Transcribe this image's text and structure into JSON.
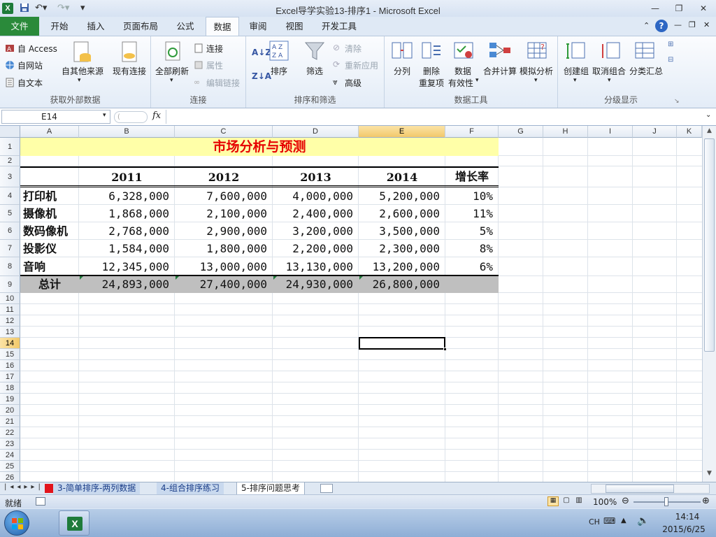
{
  "titlebar": {
    "title": "Excel导学实验13-排序1  -  Microsoft Excel",
    "app_icon": "X",
    "undo_icon": "undo-icon",
    "redo_icon": "redo-icon"
  },
  "ribbon_tabs": [
    "文件",
    "开始",
    "插入",
    "页面布局",
    "公式",
    "数据",
    "审阅",
    "视图",
    "开发工具"
  ],
  "active_tab": "数据",
  "ribbon": {
    "groups": {
      "external": {
        "label": "获取外部数据",
        "access": "自 Access",
        "web": "自网站",
        "text": "自文本",
        "other": "自其他来源",
        "existing": "现有连接"
      },
      "connections": {
        "label": "连接",
        "refresh": "全部刷新",
        "connect": "连接",
        "properties": "属性",
        "edit_links": "编辑链接"
      },
      "sort_filter": {
        "label": "排序和筛选",
        "sort": "排序",
        "filter": "筛选",
        "clear": "清除",
        "reapply": "重新应用",
        "advanced": "高级",
        "az": "A↓Z",
        "za": "Z↓A"
      },
      "data_tools": {
        "label": "数据工具",
        "split": "分列",
        "remove_dup_1": "删除",
        "remove_dup_2": "重复项",
        "validation_1": "数据",
        "validation_2": "有效性",
        "consolidate": "合并计算",
        "whatif": "模拟分析"
      },
      "outline": {
        "label": "分级显示",
        "group": "创建组",
        "ungroup": "取消组合",
        "subtotal": "分类汇总"
      }
    }
  },
  "formula_bar": {
    "name_box": "E14",
    "fx": "fx",
    "formula": ""
  },
  "columns": [
    "A",
    "B",
    "C",
    "D",
    "E",
    "F",
    "G",
    "H",
    "I",
    "J",
    "K"
  ],
  "rows": [
    "1",
    "2",
    "3",
    "4",
    "5",
    "6",
    "7",
    "8",
    "9",
    "10",
    "11",
    "12",
    "13",
    "14",
    "15",
    "16",
    "17",
    "18",
    "19",
    "20",
    "21",
    "22",
    "23",
    "24",
    "25",
    "26"
  ],
  "sheet": {
    "title": "市场分析与预测",
    "headers": [
      "2011",
      "2012",
      "2013",
      "2014",
      "增长率"
    ],
    "data": [
      {
        "name": "打印机",
        "values": [
          "6,328,000",
          "7,600,000",
          "4,000,000",
          "5,200,000"
        ],
        "growth": "10%"
      },
      {
        "name": "摄像机",
        "values": [
          "1,868,000",
          "2,100,000",
          "2,400,000",
          "2,600,000"
        ],
        "growth": "11%"
      },
      {
        "name": "数码像机",
        "values": [
          "2,768,000",
          "2,900,000",
          "3,200,000",
          "3,500,000"
        ],
        "growth": "5%"
      },
      {
        "name": "投影仪",
        "values": [
          "1,584,000",
          "1,800,000",
          "2,200,000",
          "2,300,000"
        ],
        "growth": "8%"
      },
      {
        "name": "音响",
        "values": [
          "12,345,000",
          "13,000,000",
          "13,130,000",
          "13,200,000"
        ],
        "growth": "6%"
      }
    ],
    "total": {
      "name": "总计",
      "values": [
        "24,893,000",
        "27,400,000",
        "24,930,000",
        "26,800,000"
      ]
    }
  },
  "sheet_tabs": [
    "3-简单排序-两列数据",
    "4-组合排序练习",
    "5-排序问题思考"
  ],
  "active_sheet": "5-排序问题思考",
  "status": {
    "ready": "就绪",
    "zoom": "100%"
  },
  "taskbar": {
    "lang": "CH",
    "time": "14:14",
    "date": "2015/6/25"
  },
  "colors": {
    "accent": "#2a8a3a",
    "title_fill": "#ffffa8",
    "title_text": "#e60000",
    "total_fill": "#bfbfbf",
    "selected_header": "#f2c96a"
  }
}
